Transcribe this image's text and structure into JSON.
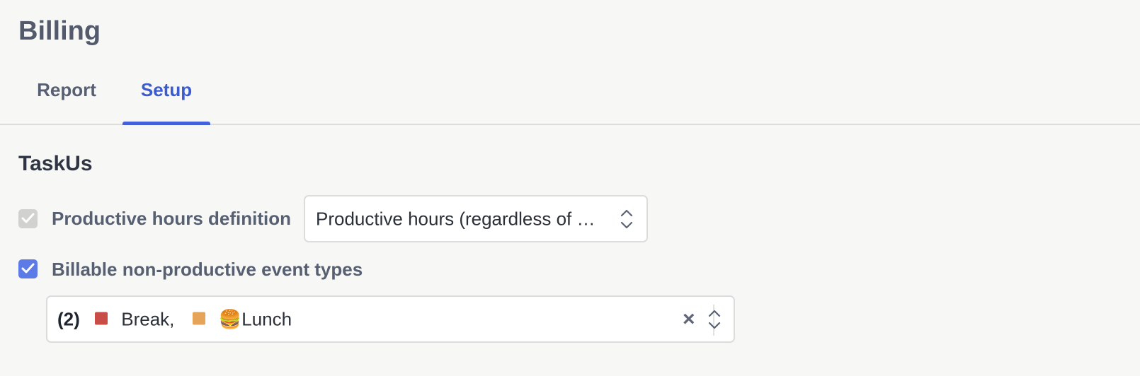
{
  "page": {
    "title": "Billing"
  },
  "tabs": [
    {
      "label": "Report",
      "active": false
    },
    {
      "label": "Setup",
      "active": true
    }
  ],
  "section": {
    "title": "TaskUs"
  },
  "productive_hours": {
    "checked": true,
    "disabled": true,
    "label": "Productive hours definition",
    "select_value": "Productive hours (regardless of …"
  },
  "billable_events": {
    "checked": true,
    "disabled": false,
    "label": "Billable non-productive event types",
    "count": "(2)",
    "items": [
      {
        "label": "Break,",
        "color": "#c94d47",
        "icon": ""
      },
      {
        "label": "Lunch",
        "color": "#e6a35a",
        "icon": "🍔"
      }
    ],
    "clear_icon": "×"
  },
  "colors": {
    "accent": "#4361d8",
    "checkbox_checked": "#5c7be7",
    "checkbox_disabled": "#d1d1cf"
  }
}
